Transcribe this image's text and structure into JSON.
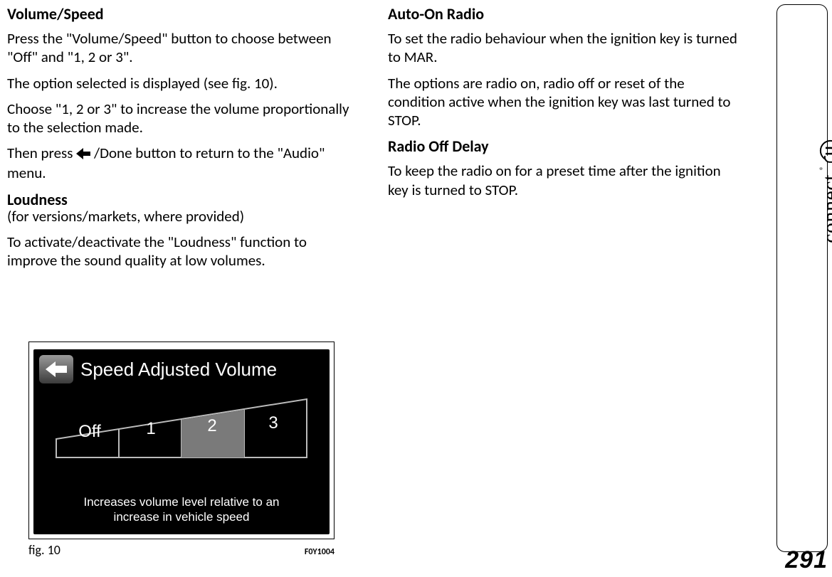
{
  "page_number": "291",
  "brand_logo_text": "connect",
  "brand_logo_letter": "U",
  "brand_registered": "®",
  "left": {
    "h1": "Volume/Speed",
    "p1": "Press the \"Volume/Speed\" button to choose between \"Off\" and \"1, 2 or 3\".",
    "p2": "The option selected is displayed (see fig. 10).",
    "p3": "Choose \"1, 2 or 3\" to increase the volume proportionally to the selection made.",
    "p4a": "Then press ",
    "p4b": " /Done button to return to the \"Audio\" menu.",
    "h2": "Loudness",
    "h2_sub": "(for versions/markets, where provided)",
    "p5": "To activate/deactivate the \"Loudness\" function to improve the sound quality at low volumes."
  },
  "right": {
    "h1": "Auto-On Radio",
    "p1": "To set the radio behaviour when the ignition key is turned to MAR.",
    "p2": "The options are radio on, radio off or reset of the condition active when the ignition key was last turned to STOP.",
    "h2": "Radio Off Delay",
    "p3": "To keep the radio on for a preset time after the ignition key is turned to STOP."
  },
  "figure": {
    "caption": "fig. 10",
    "code": "F0Y1004",
    "screen_title": "Speed Adjusted Volume",
    "options": {
      "o0": "Off",
      "o1": "1",
      "o2": "2",
      "o3": "3"
    },
    "selected_index": 2,
    "footer_line1": "Increases volume level relative to an",
    "footer_line2": "increase in vehicle speed"
  }
}
